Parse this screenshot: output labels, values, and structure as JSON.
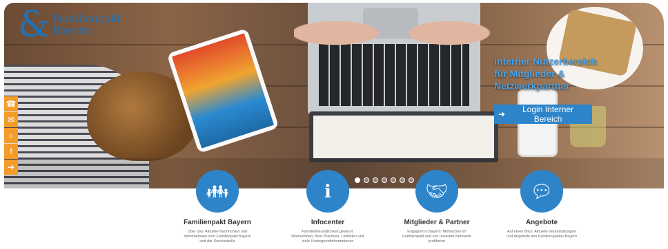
{
  "logo": {
    "amp": "&",
    "line1": "Familienpakt",
    "line2": "Bayern"
  },
  "hero": {
    "line1": "interner Nutzerbereich",
    "line2": "für Mitglieder &",
    "line3": "Netzwerkpartner",
    "login_label": "Login Interner Bereich",
    "carousel_count": 7,
    "carousel_active": 1
  },
  "side_icons": [
    "phone-icon",
    "mail-icon",
    "search-icon",
    "facebook-icon",
    "login-icon"
  ],
  "features": [
    {
      "icon": "family-icon",
      "title": "Familienpakt Bayern",
      "desc1": "Über uns: Aktuelle Nachrichten und",
      "desc2": "Informationen zum Familienpakt Bayern",
      "desc3": "und der Servicestelle"
    },
    {
      "icon": "info-icon",
      "title": "Infocenter",
      "desc1": "Familienfreundlichkeit gewinnt:",
      "desc2": "Maßnahmen, Best Practices, Leitfäden und",
      "desc3": "viele Hintergrundinformationen"
    },
    {
      "icon": "handshake-icon",
      "title": "Mitglieder & Partner",
      "desc1": "Engagiert in Bayern: Mitmachen im",
      "desc2": "Familienpakt und von unserem Netzwerk",
      "desc3": "profitieren"
    },
    {
      "icon": "chat-icon",
      "title": "Angebote",
      "desc1": "Auf einen Blick: Aktuelle Veranstaltungen",
      "desc2": "und Angebote des Familienpaktes Bayern",
      "desc3": ""
    }
  ],
  "colors": {
    "brand_blue": "#2d84c9",
    "side_orange": "#f39c2a"
  }
}
